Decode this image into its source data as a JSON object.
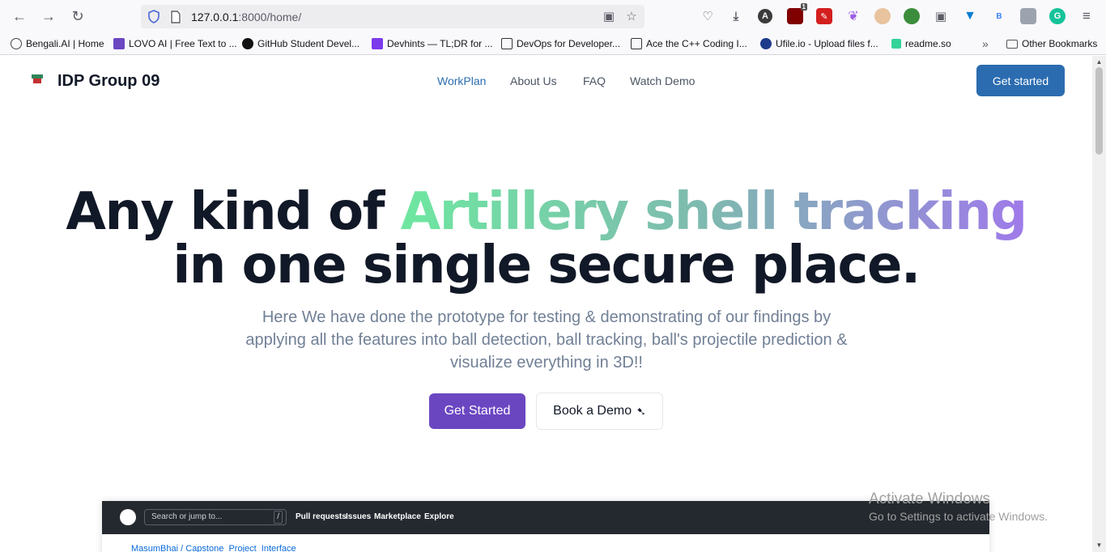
{
  "browser": {
    "url_host": "127.0.0.1",
    "url_path": ":8000/home/",
    "bookmarks": [
      "Bengali.AI | Home",
      "LOVO AI | Free Text to ...",
      "GitHub Student Devel...",
      "Devhints — TL;DR for ...",
      "DevOps for Developer...",
      "Ace the C++ Coding I...",
      "Ufile.io - Upload files f...",
      "readme.so"
    ],
    "other_bookmarks": "Other Bookmarks",
    "ext_badge": "1",
    "ext_letter_a": "A",
    "ext_letter_b": "B"
  },
  "site": {
    "brand": "IDP Group 09",
    "nav": [
      "WorkPlan",
      "About Us",
      "FAQ",
      "Watch Demo"
    ],
    "cta": "Get started",
    "hero": {
      "line1_plain": "Any kind of ",
      "line1_gradient": "Artillery shell tracking",
      "line2": "in one single secure place.",
      "subtitle": "Here We have done the prototype for testing & demonstrating of our findings by applying all the features into ball detection, ball tracking, ball's projectile prediction & visualize everything in 3D!!",
      "primary_button": "Get Started",
      "secondary_button": "Book a Demo"
    },
    "preview": {
      "search": "Search or jump to...",
      "slash": "/",
      "links": [
        "Pull requests",
        "Issues",
        "Marketplace",
        "Explore"
      ],
      "repo": "MasumBhai / Capstone_Project_Interface"
    }
  },
  "watermark": {
    "line1": "Activate Windows",
    "line2": "Go to Settings to activate Windows."
  },
  "colors": {
    "primary_blue": "#2b6cb0",
    "primary_purple": "#6b46c1",
    "gradient": [
      "#6ee7a0",
      "#9f7aea"
    ]
  }
}
